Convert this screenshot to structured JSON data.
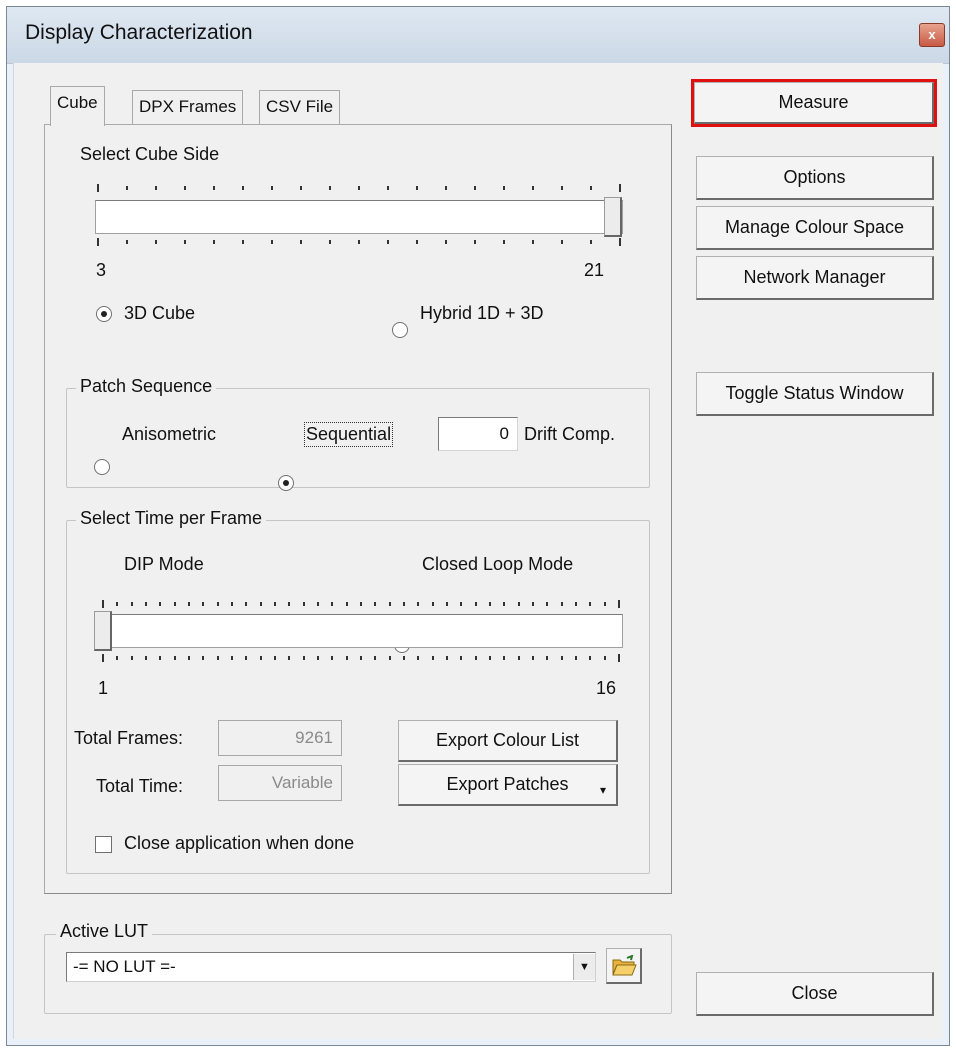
{
  "window": {
    "title": "Display Characterization",
    "close_glyph": "x"
  },
  "tabs": [
    {
      "label": "Cube",
      "active": true
    },
    {
      "label": "DPX Frames",
      "active": false
    },
    {
      "label": "CSV File",
      "active": false
    }
  ],
  "cube_side": {
    "label": "Select Cube Side",
    "min_label": "3",
    "max_label": "21",
    "value": 21,
    "min": 3,
    "max": 21
  },
  "cube_mode": {
    "option_3d": "3D Cube",
    "option_hybrid": "Hybrid 1D + 3D",
    "selected": "3D Cube"
  },
  "patch_sequence": {
    "title": "Patch Sequence",
    "option_anisometric": "Anisometric",
    "option_sequential": "Sequential",
    "selected": "Sequential",
    "drift_value": "0",
    "drift_label": "Drift Comp."
  },
  "time_per_frame": {
    "title": "Select Time per Frame",
    "option_dip": "DIP Mode",
    "option_closed_loop": "Closed Loop Mode",
    "selected": "Closed Loop Mode",
    "min_label": "1",
    "max_label": "16",
    "value": 1,
    "min": 1,
    "max": 16
  },
  "totals": {
    "frames_label": "Total Frames:",
    "frames_value": "9261",
    "time_label": "Total Time:",
    "time_value": "Variable"
  },
  "export": {
    "colour_list_label": "Export Colour List",
    "patches_label": "Export Patches",
    "patches_arrow": "▾"
  },
  "close_when_done": {
    "label": "Close application when done",
    "checked": false
  },
  "active_lut": {
    "title": "Active LUT",
    "value": "-= NO LUT =-",
    "arrow": "▼"
  },
  "side_buttons": {
    "measure": "Measure",
    "options": "Options",
    "manage_colour_space": "Manage Colour Space",
    "network_manager": "Network Manager",
    "toggle_status_window": "Toggle Status Window",
    "close": "Close"
  },
  "accent_colors": {
    "highlight_outline": "#e01010"
  }
}
